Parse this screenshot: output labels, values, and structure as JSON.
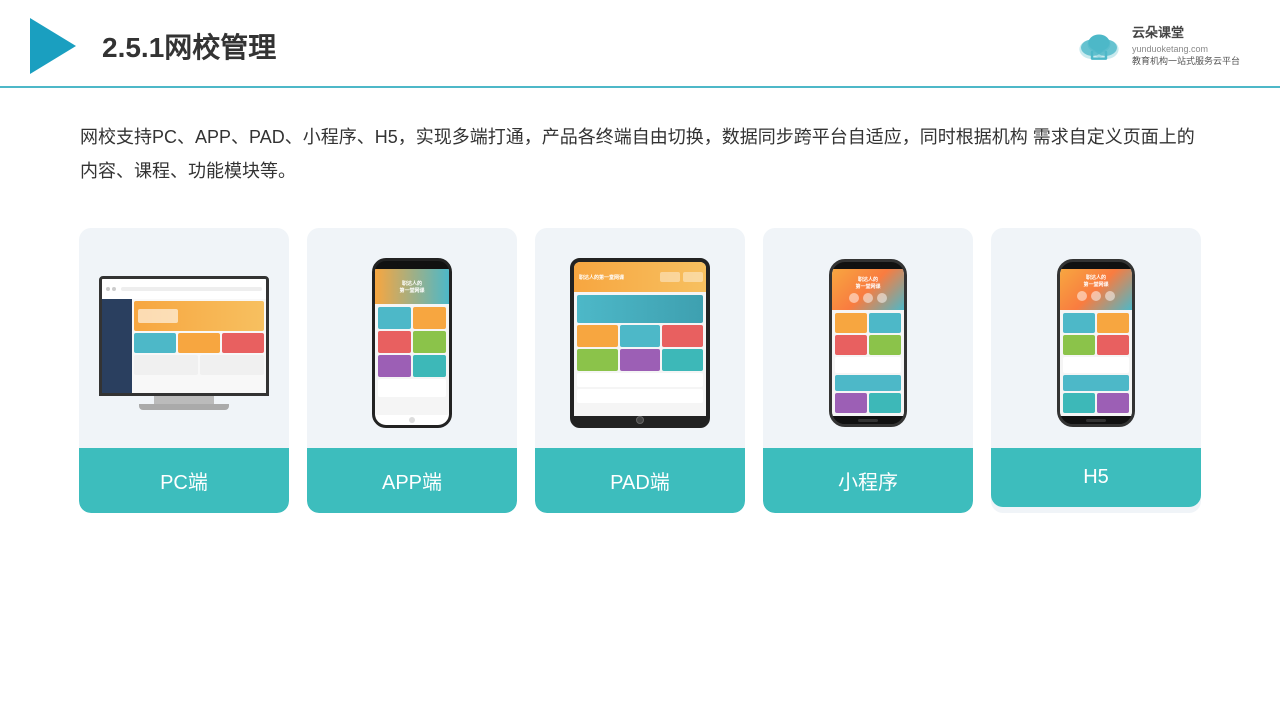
{
  "header": {
    "title": "2.5.1网校管理",
    "logo_name": "云朵课堂",
    "logo_subtitle": "yunduoketang.com",
    "logo_tagline": "教育机构一站\n式服务云平台"
  },
  "description": {
    "text": "网校支持PC、APP、PAD、小程序、H5，实现多端打通，产品各终端自由切换，数据同步跨平台自适应，同时根据机构\n需求自定义页面上的内容、课程、功能模块等。"
  },
  "cards": [
    {
      "label": "PC端",
      "type": "pc"
    },
    {
      "label": "APP端",
      "type": "phone"
    },
    {
      "label": "PAD端",
      "type": "tablet"
    },
    {
      "label": "小程序",
      "type": "mini-program"
    },
    {
      "label": "H5",
      "type": "h5"
    }
  ]
}
